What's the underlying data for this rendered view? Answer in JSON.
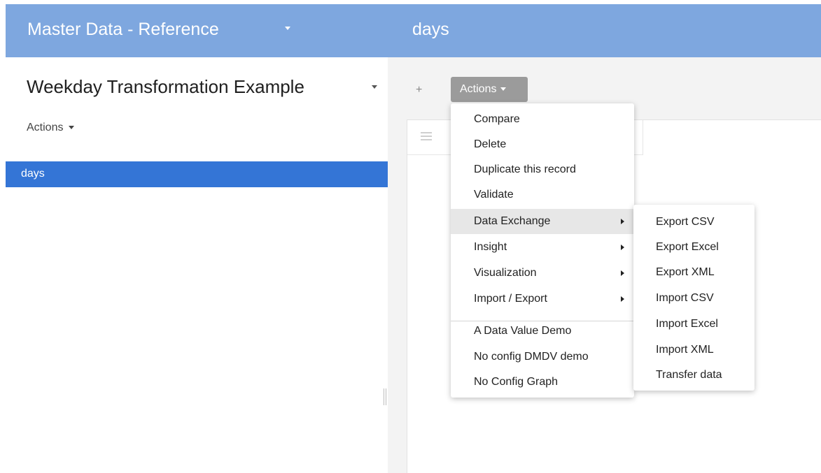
{
  "header": {
    "app_title": "Master Data - Reference",
    "page_title": "days"
  },
  "left_panel": {
    "dataset_title": "Weekday Transformation Example",
    "actions_label": "Actions",
    "tables": [
      "days"
    ]
  },
  "right_panel": {
    "add_label": "+",
    "actions_label": "Actions"
  },
  "actions_menu": {
    "items": [
      {
        "label": "Compare"
      },
      {
        "label": "Delete"
      },
      {
        "label": "Duplicate this record"
      },
      {
        "label": "Validate"
      },
      {
        "label": "Data Exchange",
        "submenu": true,
        "active": true
      },
      {
        "label": "Insight",
        "submenu": true
      },
      {
        "label": "Visualization",
        "submenu": true
      },
      {
        "label": "Import / Export",
        "submenu": true
      },
      {
        "label": "A Data Value Demo"
      },
      {
        "label": "No config DMDV demo"
      },
      {
        "label": "No Config Graph"
      }
    ]
  },
  "data_exchange_submenu": {
    "items": [
      "Export CSV",
      "Export Excel",
      "Export XML",
      "Import CSV",
      "Import Excel",
      "Import XML",
      "Transfer data"
    ]
  },
  "colors": {
    "header_bg": "#7ea7df",
    "selected_bg": "#3475d6",
    "actions_button_bg": "#9b9b9b"
  }
}
